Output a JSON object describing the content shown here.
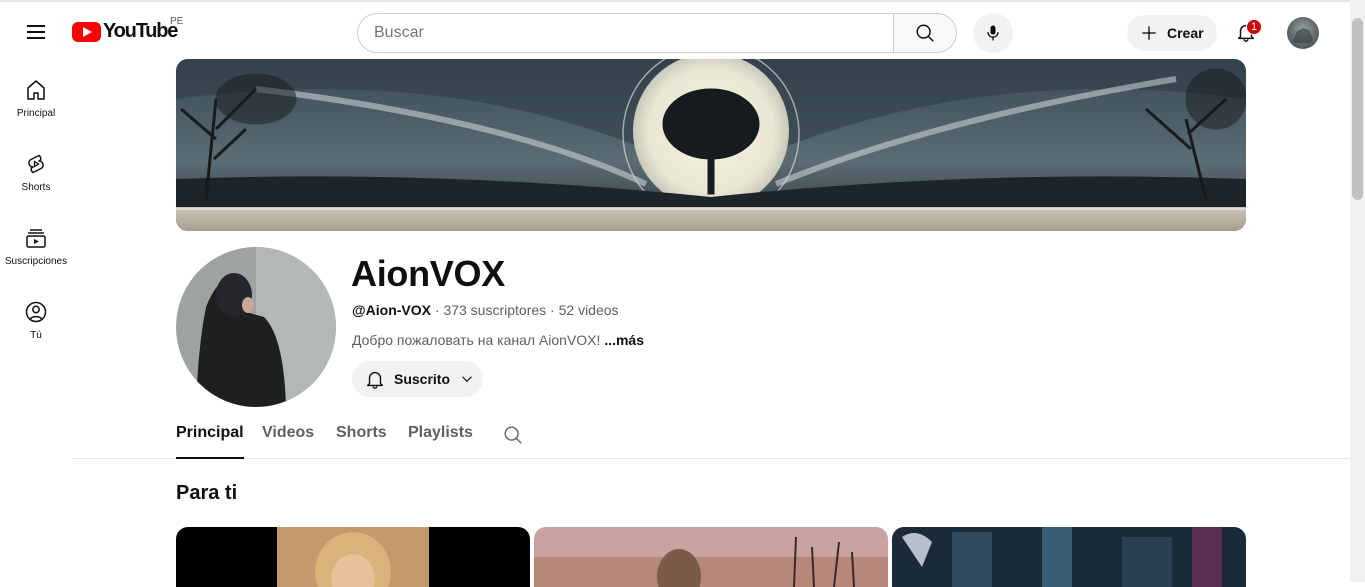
{
  "header": {
    "logo_text": "YouTube",
    "country_code": "PE",
    "search_placeholder": "Buscar",
    "create_label": "Crear",
    "notifications_count": "1"
  },
  "sidebar": {
    "items": [
      {
        "label": "Principal",
        "icon": "home-icon"
      },
      {
        "label": "Shorts",
        "icon": "shorts-icon"
      },
      {
        "label": "Suscripciones",
        "icon": "subscriptions-icon"
      },
      {
        "label": "Tú",
        "icon": "you-icon"
      }
    ]
  },
  "channel": {
    "name": "AionVOX",
    "handle": "@Aion-VOX",
    "subscribers": "373 suscriptores",
    "videos": "52 videos",
    "separator": "·",
    "description": "Добро пожаловать на канал AionVOX!",
    "more_label": "...más",
    "subscribe_label": "Suscrito"
  },
  "tabs": [
    {
      "label": "Principal",
      "active": true
    },
    {
      "label": "Videos",
      "active": false
    },
    {
      "label": "Shorts",
      "active": false
    },
    {
      "label": "Playlists",
      "active": false
    }
  ],
  "section": {
    "title": "Para ti"
  },
  "colors": {
    "brand_red": "#ff0000",
    "badge_red": "#cc0000",
    "text_primary": "#0f0f0f",
    "text_secondary": "#606060"
  }
}
